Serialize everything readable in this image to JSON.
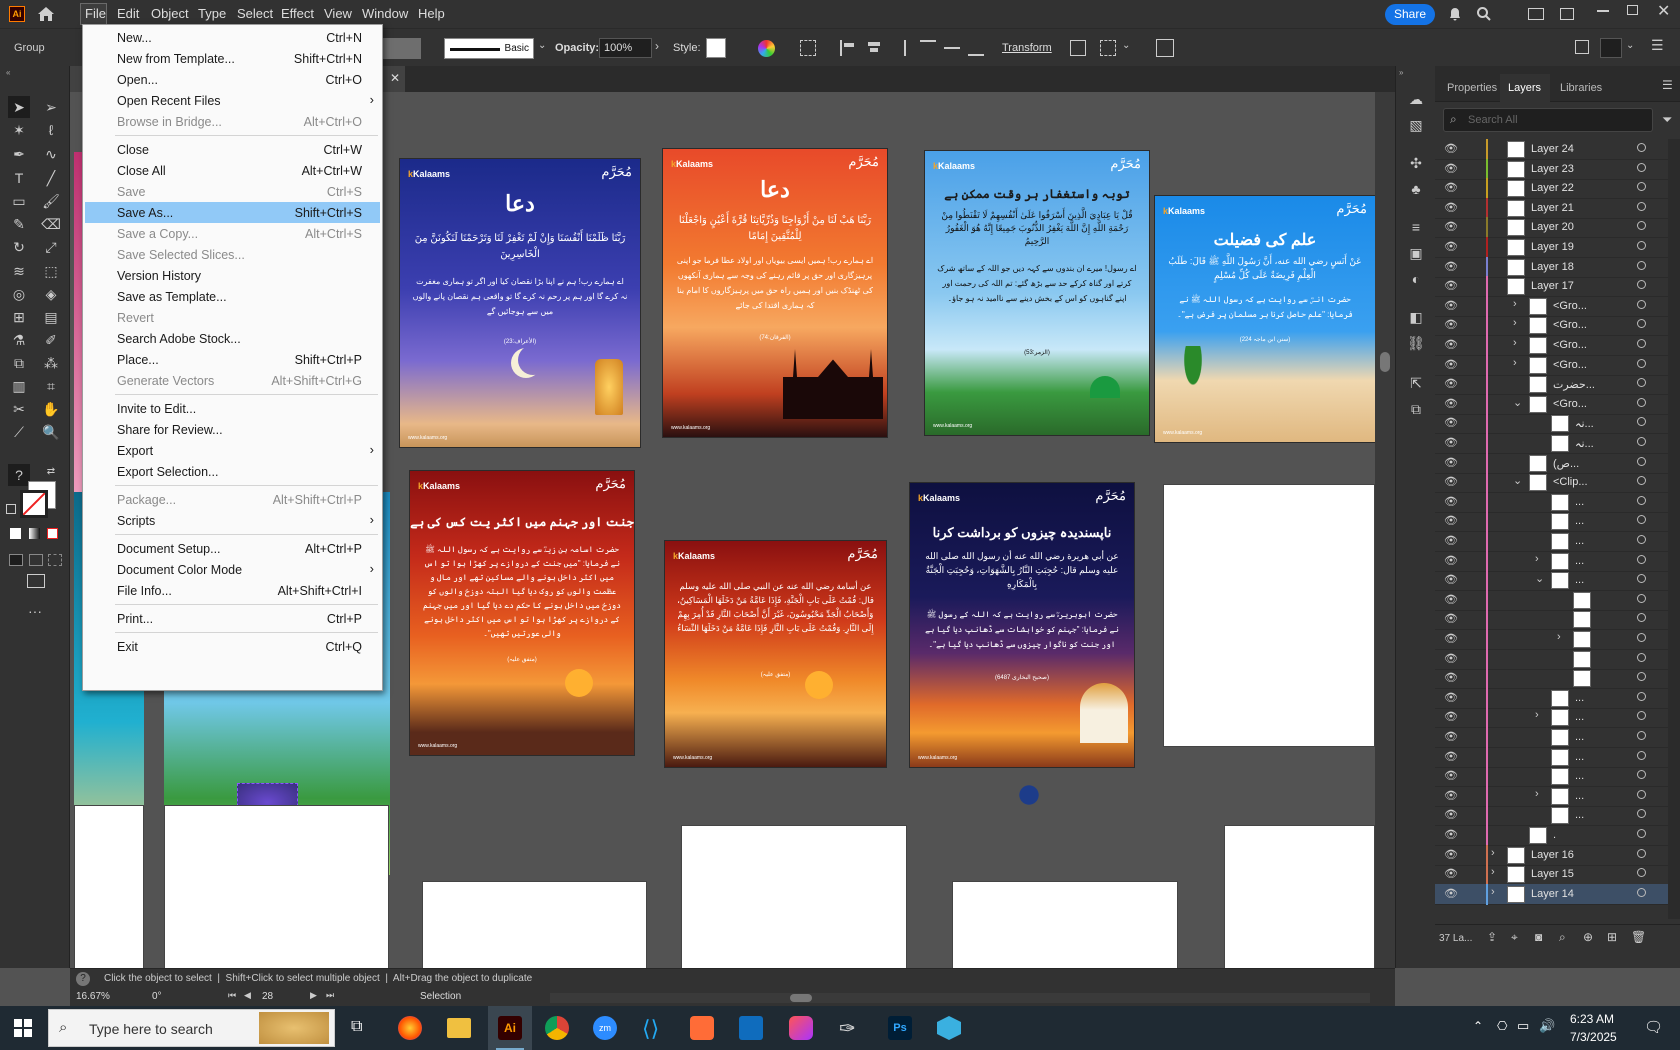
{
  "app": {
    "logo": "Ai",
    "share_label": "Share"
  },
  "menubar": [
    "File",
    "Edit",
    "Object",
    "Type",
    "Select",
    "Effect",
    "View",
    "Window",
    "Help"
  ],
  "control": {
    "selection_type": "Group",
    "stroke_style": "Basic",
    "opacity_label": "Opacity:",
    "opacity_value": "100%",
    "style_label": "Style:",
    "transform_label": "Transform"
  },
  "file_menu": [
    {
      "label": "New...",
      "shortcut": "Ctrl+N"
    },
    {
      "label": "New from Template...",
      "shortcut": "Shift+Ctrl+N"
    },
    {
      "label": "Open...",
      "shortcut": "Ctrl+O"
    },
    {
      "label": "Open Recent Files",
      "submenu": true
    },
    {
      "label": "Browse in Bridge...",
      "shortcut": "Alt+Ctrl+O",
      "disabled": true
    },
    {
      "sep": true
    },
    {
      "label": "Close",
      "shortcut": "Ctrl+W"
    },
    {
      "label": "Close All",
      "shortcut": "Alt+Ctrl+W"
    },
    {
      "label": "Save",
      "shortcut": "Ctrl+S",
      "disabled": true
    },
    {
      "label": "Save As...",
      "shortcut": "Shift+Ctrl+S",
      "selected": true
    },
    {
      "label": "Save a Copy...",
      "shortcut": "Alt+Ctrl+S",
      "disabled": true
    },
    {
      "label": "Save Selected Slices...",
      "disabled": true
    },
    {
      "label": "Version History"
    },
    {
      "label": "Save as Template..."
    },
    {
      "label": "Revert",
      "disabled": true
    },
    {
      "label": "Search Adobe Stock..."
    },
    {
      "label": "Place...",
      "shortcut": "Shift+Ctrl+P"
    },
    {
      "label": "Generate Vectors",
      "shortcut": "Alt+Shift+Ctrl+G",
      "disabled": true
    },
    {
      "sep": true
    },
    {
      "label": "Invite to Edit..."
    },
    {
      "label": "Share for Review..."
    },
    {
      "label": "Export",
      "submenu": true
    },
    {
      "label": "Export Selection..."
    },
    {
      "sep": true
    },
    {
      "label": "Package...",
      "shortcut": "Alt+Shift+Ctrl+P",
      "disabled": true
    },
    {
      "label": "Scripts",
      "submenu": true
    },
    {
      "sep": true
    },
    {
      "label": "Document Setup...",
      "shortcut": "Alt+Ctrl+P"
    },
    {
      "label": "Document Color Mode",
      "submenu": true
    },
    {
      "label": "File Info...",
      "shortcut": "Alt+Shift+Ctrl+I"
    },
    {
      "sep": true
    },
    {
      "label": "Print...",
      "shortcut": "Ctrl+P"
    },
    {
      "sep": true
    },
    {
      "label": "Exit",
      "shortcut": "Ctrl+Q"
    }
  ],
  "panel": {
    "tabs": [
      "Properties",
      "Layers",
      "Libraries"
    ],
    "search_placeholder": "Search All",
    "footer_count": "37 La..."
  },
  "layers": [
    {
      "name": "Layer 24",
      "color": "#c89b2a",
      "depth": 0
    },
    {
      "name": "Layer 23",
      "color": "#7bbd2e",
      "depth": 0
    },
    {
      "name": "Layer 22",
      "color": "#c8a020",
      "depth": 0
    },
    {
      "name": "Layer 21",
      "color": "#b33030",
      "depth": 0
    },
    {
      "name": "Layer 20",
      "color": "#8a7a2a",
      "depth": 0
    },
    {
      "name": "Layer 19",
      "color": "#b02020",
      "depth": 0
    },
    {
      "name": "Layer 18",
      "color": "#7a80d0",
      "depth": 0
    },
    {
      "name": "Layer 17",
      "color": "#e06ab0",
      "depth": 0,
      "expanded": true
    },
    {
      "name": "<Gro...",
      "color": "#e06ab0",
      "depth": 1,
      "arrow": "right"
    },
    {
      "name": "<Gro...",
      "color": "#e06ab0",
      "depth": 1,
      "arrow": "right"
    },
    {
      "name": "<Gro...",
      "color": "#e06ab0",
      "depth": 1,
      "arrow": "right"
    },
    {
      "name": "<Gro...",
      "color": "#e06ab0",
      "depth": 1,
      "arrow": "right"
    },
    {
      "name": "حضرت...",
      "color": "#e06ab0",
      "depth": 1
    },
    {
      "name": "<Gro...",
      "color": "#e06ab0",
      "depth": 1,
      "arrow": "down"
    },
    {
      "name": "نہ...",
      "color": "#e06ab0",
      "depth": 2
    },
    {
      "name": "نہ...",
      "color": "#e06ab0",
      "depth": 2
    },
    {
      "name": "(ص...",
      "color": "#e06ab0",
      "depth": 1
    },
    {
      "name": "<Clip...",
      "color": "#e06ab0",
      "depth": 1,
      "arrow": "down"
    },
    {
      "name": "...",
      "color": "#e06ab0",
      "depth": 2
    },
    {
      "name": "...",
      "color": "#e06ab0",
      "depth": 2
    },
    {
      "name": "...",
      "color": "#e06ab0",
      "depth": 2
    },
    {
      "name": "...",
      "color": "#e06ab0",
      "depth": 2,
      "arrow": "right"
    },
    {
      "name": "...",
      "color": "#e06ab0",
      "depth": 2,
      "arrow": "down"
    },
    {
      "name": "",
      "color": "#e06ab0",
      "depth": 3
    },
    {
      "name": "",
      "color": "#e06ab0",
      "depth": 3
    },
    {
      "name": "",
      "color": "#e06ab0",
      "depth": 3,
      "arrow": "right"
    },
    {
      "name": "",
      "color": "#e06ab0",
      "depth": 3
    },
    {
      "name": "",
      "color": "#e06ab0",
      "depth": 3
    },
    {
      "name": "...",
      "color": "#e06ab0",
      "depth": 2
    },
    {
      "name": "...",
      "color": "#e06ab0",
      "depth": 2,
      "arrow": "right"
    },
    {
      "name": "...",
      "color": "#e06ab0",
      "depth": 2
    },
    {
      "name": "...",
      "color": "#e06ab0",
      "depth": 2
    },
    {
      "name": "...",
      "color": "#e06ab0",
      "depth": 2
    },
    {
      "name": "...",
      "color": "#e06ab0",
      "depth": 2,
      "arrow": "right"
    },
    {
      "name": "...",
      "color": "#e06ab0",
      "depth": 2
    },
    {
      "name": ".",
      "color": "#e06ab0",
      "depth": 1
    },
    {
      "name": "Layer 16",
      "color": "#d07050",
      "depth": 0,
      "arrow": "right"
    },
    {
      "name": "Layer 15",
      "color": "#d07050",
      "depth": 0,
      "arrow": "right"
    },
    {
      "name": "Layer 14",
      "color": "#60a0e0",
      "depth": 0,
      "arrow": "right",
      "active": true
    }
  ],
  "posters": [
    {
      "title": "دعا",
      "arabic": "رَبَّنَا ظَلَمْنَا أَنْفُسَنَا وَإِنْ لَمْ تَغْفِرْ لَنَا وَتَرْحَمْنَا لَنَكُونَنَّ مِنَ الْخَاسِرِينَ",
      "urdu": "اے ہمارے رب! ہم نے اپنا بڑا نقصان کیا اور اگر تو ہماری مغفرت نہ کرے گا اور ہم پر رحم نہ کرے گا تو واقعی ہم نقصان پانے والوں میں سے ہوجائیں گے",
      "ref": "(الأعراف:23)",
      "foot": "www.kalaams.org"
    },
    {
      "title": "دعا",
      "arabic": "رَبَّنَا هَبْ لَنَا مِنْ أَزْوَاجِنَا وَذُرِّيَّاتِنَا قُرَّةَ أَعْيُنٍ وَاجْعَلْنَا لِلْمُتَّقِينَ إِمَامًا",
      "urdu": "اے ہمارے رب! ہمیں ایسی بیویاں اور اولاد عطا فرما جو اپنی پرہیزگاری اور حق پر قائم رہنے کی وجہ سے ہماری آنکھوں کی ٹھنڈک بنیں اور ہمیں راہ حق میں پرہیزگاروں کا امام بنا کہ ہماری اقتدا کی جائے",
      "ref": "(الفرقان:74)",
      "foot": "www.kalaams.org"
    },
    {
      "title": "توبہ واستغفار ہر وقت ممکن ہے",
      "arabic": "قُلْ يَا عِبَادِيَ الَّذِينَ أَسْرَفُوا عَلَىٰ أَنْفُسِهِمْ لَا تَقْنَطُوا مِنْ رَحْمَةِ اللَّهِ إِنَّ اللَّهَ يَغْفِرُ الذُّنُوبَ جَمِيعًا إِنَّهُ هُوَ الْغَفُورُ الرَّحِيمُ",
      "urdu": "اے رسول! میرے ان بندوں سے کہہ دیں جو اللہ کے ساتھ شرک کرتے اور گناہ کرکے حد سے بڑھ گئے: تم اللہ کی رحمت اور اپنے گناہوں کو اس کے بخش دینے سے ناامید نہ ہو جاؤ۔",
      "ref": "(الزمر:53)",
      "foot": "www.kalaams.org"
    },
    {
      "title": "علم کی فضیلت",
      "arabic": "عَنْ أَنَسٍ رضي الله عنه، أَنَّ رَسُولَ اللَّهِ ﷺ قَالَ: طَلَبُ الْعِلْمِ فَرِيضَةٌ عَلَى كُلِّ مُسْلِمٍ",
      "urdu": "حضرت انسؓ سے روایت ہے کہ رسول اللہ ﷺ نے فرمایا: \"علم حاصل کرنا ہر مسلمان پر فرض ہے\"۔",
      "ref": "(سنن ابن ماجہ 224)",
      "foot": "www.kalaams.org"
    },
    {
      "title": "جنت اور جہنم میں اکثر یت کس کی ہے",
      "arabic": "",
      "urdu": "حضرت اسامہ بن زیدؓ سے روایت ہے کہ رسول اللہ ﷺ نے فرمایا: \"میں جنت کے دروازے پر کھڑا ہوا تو اس میں اکثر داخل ہونے والے مساکین تھے اور مال و عظمت والوں کو روک دیا گیا البتہ دوزخ والوں کو دوزخ میں داخل ہونے کا حکم دے دیا گیا اور میں جہنم کے دروازے پر کھڑا ہوا تو اس میں اکثر داخل ہونے والی عورتیں تھیں\"۔",
      "ref": "(متفق علیہ)",
      "foot": "www.kalaams.org"
    },
    {
      "title": "",
      "arabic": "عن أسامة رضي الله عنه عن النبي صلى الله عليه وسلم قال: قُمْتُ عَلَى بَابِ الْجَنَّةِ، فَإِذَا عَامَّةُ مَنْ دَخَلَهَا الْمَسَاكِينُ، وَأَصْحَابُ الْجَدِّ مَحْبُوسُونَ، غَيْرَ أَنَّ أَصْحَابَ النَّارِ قَدْ أُمِرَ بِهِمْ إِلَى النَّارِ. وَقُمْتُ عَلَى بَابِ النَّارِ فَإِذَا عَامَّةُ مَنْ دَخَلَهَا النِّسَاءُ",
      "urdu": "",
      "ref": "(متفق علیہ)",
      "foot": "www.kalaams.org"
    },
    {
      "title": "ناپسندیدہ چیزوں کو برداشت کرنا",
      "arabic": "عن أبي هريرة رضي الله عنه أن رسول الله صلى الله عليه وسلم قال: حُجِبَتِ النَّارُ بِالشَّهَوَاتِ، وَحُجِبَتِ الْجَنَّةُ بِالْمَكَارِهِ",
      "urdu": "حضرت ابوہریرہؓ سے روایت ہے کہ اللہ کے رسول ﷺ نے فرمایا: \"جہنم کو خواہشات سے ڈھانپ دیا گیا ہے اور جنت کو ناگوار چیزوں سے ڈھانپ دیا گیا ہے\"۔",
      "ref": "(صحیح البخاری 6487)",
      "foot": "www.kalaams.org"
    }
  ],
  "poster_brand": {
    "name": "Kalaams",
    "icon": "k",
    "mark": "مُحَرَّم"
  },
  "status": {
    "hint": "Click the object to select  |  Shift+Click to select multiple object  |  Alt+Drag the object to duplicate",
    "zoom": "16.67%",
    "rotate": "0°",
    "artboard": "28",
    "tool": "Selection"
  },
  "taskbar": {
    "search_placeholder": "Type here to search",
    "time": "6:23 AM",
    "date": "7/3/2025"
  }
}
